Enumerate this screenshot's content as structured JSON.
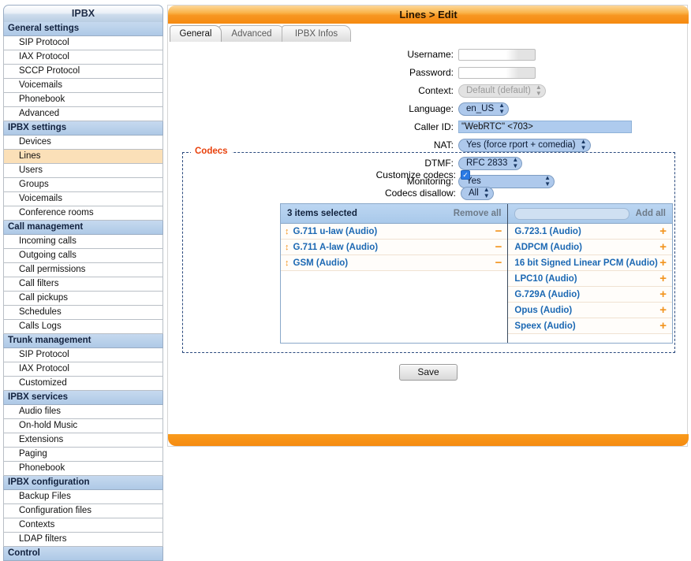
{
  "sidebar": {
    "title": "IPBX",
    "sections": [
      {
        "label": "General settings",
        "items": [
          {
            "label": "SIP Protocol",
            "active": false
          },
          {
            "label": "IAX Protocol",
            "active": false
          },
          {
            "label": "SCCP Protocol",
            "active": false
          },
          {
            "label": "Voicemails",
            "active": false
          },
          {
            "label": "Phonebook",
            "active": false
          },
          {
            "label": "Advanced",
            "active": false
          }
        ]
      },
      {
        "label": "IPBX settings",
        "items": [
          {
            "label": "Devices",
            "active": false
          },
          {
            "label": "Lines",
            "active": true
          },
          {
            "label": "Users",
            "active": false
          },
          {
            "label": "Groups",
            "active": false
          },
          {
            "label": "Voicemails",
            "active": false
          },
          {
            "label": "Conference rooms",
            "active": false
          }
        ]
      },
      {
        "label": "Call management",
        "items": [
          {
            "label": "Incoming calls",
            "active": false
          },
          {
            "label": "Outgoing calls",
            "active": false
          },
          {
            "label": "Call permissions",
            "active": false
          },
          {
            "label": "Call filters",
            "active": false
          },
          {
            "label": "Call pickups",
            "active": false
          },
          {
            "label": "Schedules",
            "active": false
          },
          {
            "label": "Calls Logs",
            "active": false
          }
        ]
      },
      {
        "label": "Trunk management",
        "items": [
          {
            "label": "SIP Protocol",
            "active": false
          },
          {
            "label": "IAX Protocol",
            "active": false
          },
          {
            "label": "Customized",
            "active": false
          }
        ]
      },
      {
        "label": "IPBX services",
        "items": [
          {
            "label": "Audio files",
            "active": false
          },
          {
            "label": "On-hold Music",
            "active": false
          },
          {
            "label": "Extensions",
            "active": false
          },
          {
            "label": "Paging",
            "active": false
          },
          {
            "label": "Phonebook",
            "active": false
          }
        ]
      },
      {
        "label": "IPBX configuration",
        "items": [
          {
            "label": "Backup Files",
            "active": false
          },
          {
            "label": "Configuration files",
            "active": false
          },
          {
            "label": "Contexts",
            "active": false
          },
          {
            "label": "LDAP filters",
            "active": false
          }
        ]
      },
      {
        "label": "Control",
        "items": []
      }
    ]
  },
  "header": {
    "title": "Lines > Edit"
  },
  "tabs": [
    {
      "label": "General",
      "active": true
    },
    {
      "label": "Advanced",
      "active": false
    },
    {
      "label": "IPBX Infos",
      "active": false
    }
  ],
  "form": {
    "username": {
      "label": "Username:",
      "value": ""
    },
    "password": {
      "label": "Password:",
      "value": ""
    },
    "context": {
      "label": "Context:",
      "value": "Default (default)",
      "disabled": true
    },
    "language": {
      "label": "Language:",
      "value": "en_US"
    },
    "callerid": {
      "label": "Caller ID:",
      "value": "\"WebRTC\" <703>"
    },
    "nat": {
      "label": "NAT:",
      "value": "Yes (force rport + comedia)"
    },
    "dtmf": {
      "label": "DTMF:",
      "value": "RFC 2833"
    },
    "monitoring": {
      "label": "Monitoring:",
      "value": "Yes"
    }
  },
  "codecs": {
    "legend": "Codecs",
    "customize_label": "Customize codecs:",
    "customize_checked": true,
    "disallow_label": "Codecs disallow:",
    "disallow_value": "All",
    "selected_header": "3 items selected",
    "remove_all_label": "Remove all",
    "add_all_label": "Add all",
    "search_placeholder": "",
    "search_value": "",
    "selected": [
      {
        "label": "G.711 u-law (Audio)"
      },
      {
        "label": "G.711 A-law (Audio)"
      },
      {
        "label": "GSM (Audio)"
      }
    ],
    "available": [
      {
        "label": "G.723.1 (Audio)"
      },
      {
        "label": "ADPCM (Audio)"
      },
      {
        "label": "16 bit Signed Linear PCM (Audio)"
      },
      {
        "label": "LPC10 (Audio)"
      },
      {
        "label": "G.729A (Audio)"
      },
      {
        "label": "Opus (Audio)"
      },
      {
        "label": "Speex (Audio)"
      }
    ]
  },
  "actions": {
    "save_label": "Save"
  },
  "colors": {
    "accent_orange": "#f58a10",
    "sidebar_group": "#aec9e6",
    "sidebar_active": "#fbe0b8",
    "select_blue": "#aec9ec",
    "codec_link": "#1b68b3",
    "codec_icon": "#f2941e",
    "legend_orange": "#e8400b",
    "checkbox_blue": "#2b7ae4"
  }
}
